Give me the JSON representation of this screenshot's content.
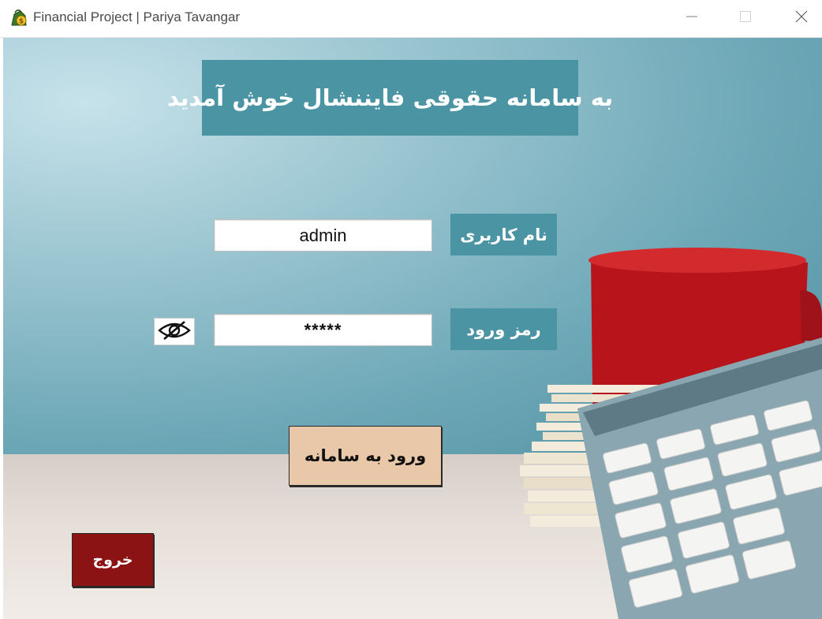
{
  "window": {
    "title": "Financial Project | Pariya Tavangar"
  },
  "banner": {
    "text": "به سامانه حقوقی فایننشال خوش آمدید"
  },
  "form": {
    "username_label": "نام کاربری",
    "username_value": "admin",
    "password_label": "رمز ورود",
    "password_value": "*****"
  },
  "buttons": {
    "login": "ورود به سامانه",
    "exit": "خروج"
  },
  "icons": {
    "app": "app-coin-icon",
    "password_toggle": "eye-slash-icon",
    "minimize": "minimize-icon",
    "maximize": "maximize-icon",
    "close": "close-icon"
  },
  "colors": {
    "label_bg": "#4b94a3",
    "login_bg": "#e8c8a8",
    "exit_bg": "#8c1313"
  }
}
